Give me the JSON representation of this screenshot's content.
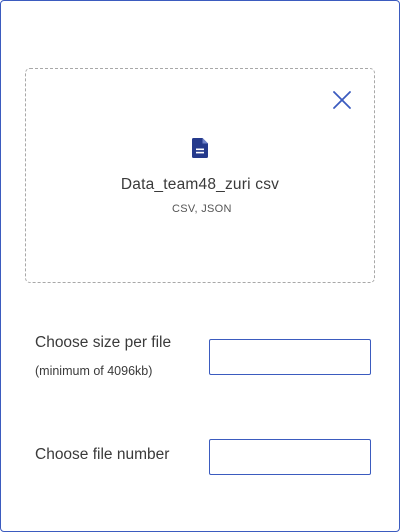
{
  "upload": {
    "file_name": "Data_team48_zuri csv",
    "file_types": "CSV, JSON"
  },
  "size_field": {
    "label": "Choose size per file",
    "hint": "(minimum of  4096kb)",
    "value": "",
    "placeholder": ""
  },
  "count_field": {
    "label": "Choose file number",
    "value": "",
    "placeholder": ""
  },
  "icons": {
    "close": "close-icon",
    "file": "file-document-icon"
  },
  "colors": {
    "accent": "#3b5bbf",
    "file_icon": "#253a8c",
    "dashed_border": "#a8a8a8",
    "text": "#3a3a3a"
  }
}
